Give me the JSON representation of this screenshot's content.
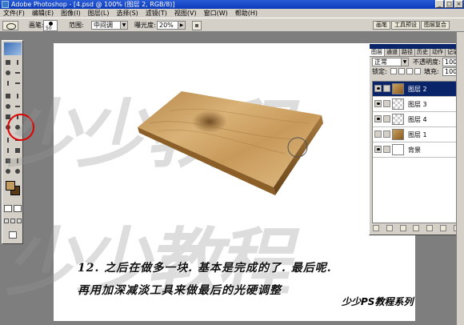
{
  "window": {
    "title": "Adobe Photoshop - [4.psd @ 100% (图层 2, RGB/8)]",
    "buttons": [
      "_",
      "□",
      "×"
    ]
  },
  "menu": [
    "文件(F)",
    "编辑(E)",
    "图像(I)",
    "图层(L)",
    "选择(S)",
    "滤镜(T)",
    "视图(V)",
    "窗口(W)",
    "帮助(H)"
  ],
  "options": {
    "brush_label": "画笔:",
    "brush_size": "50",
    "range_label": "范围:",
    "range_value": "中间调",
    "exposure_label": "曝光度:",
    "exposure_value": "20%",
    "palette_tabs": [
      "画笔",
      "工具预设",
      "图层复合"
    ]
  },
  "layers_panel": {
    "tabs": [
      "图层",
      "通道",
      "路径",
      "历史",
      "动作",
      "记录"
    ],
    "blend_mode": "正常",
    "opacity_label": "不透明度:",
    "opacity_value": "100%",
    "lock_label": "锁定:",
    "fill_label": "填充:",
    "fill_value": "100%",
    "layers": [
      {
        "name": "图层 2",
        "selected": true,
        "visible": true,
        "thumb": "wood-icon"
      },
      {
        "name": "图层 3",
        "selected": false,
        "visible": true,
        "thumb": "transparent-icon"
      },
      {
        "name": "图层 4",
        "selected": false,
        "visible": true,
        "thumb": "transparent-icon"
      },
      {
        "name": "图层 1",
        "selected": false,
        "visible": false,
        "thumb": "wood-icon"
      },
      {
        "name": "背景",
        "selected": false,
        "visible": true,
        "thumb": "white-icon"
      }
    ]
  },
  "canvas": {
    "watermark_1": "少少教程",
    "watermark_2": "少少教程",
    "caption_1": "12. 之后在做多一块. 基本是完成的了. 最后呢.",
    "caption_2": "再用加深减淡工具来做最后的光硬调整",
    "brand": "少少PS教程系列"
  },
  "colors": {
    "foreground": "#c39c62",
    "background": "#5a3a14",
    "highlight_circle": "#e00000",
    "selection": "#0a246a"
  }
}
